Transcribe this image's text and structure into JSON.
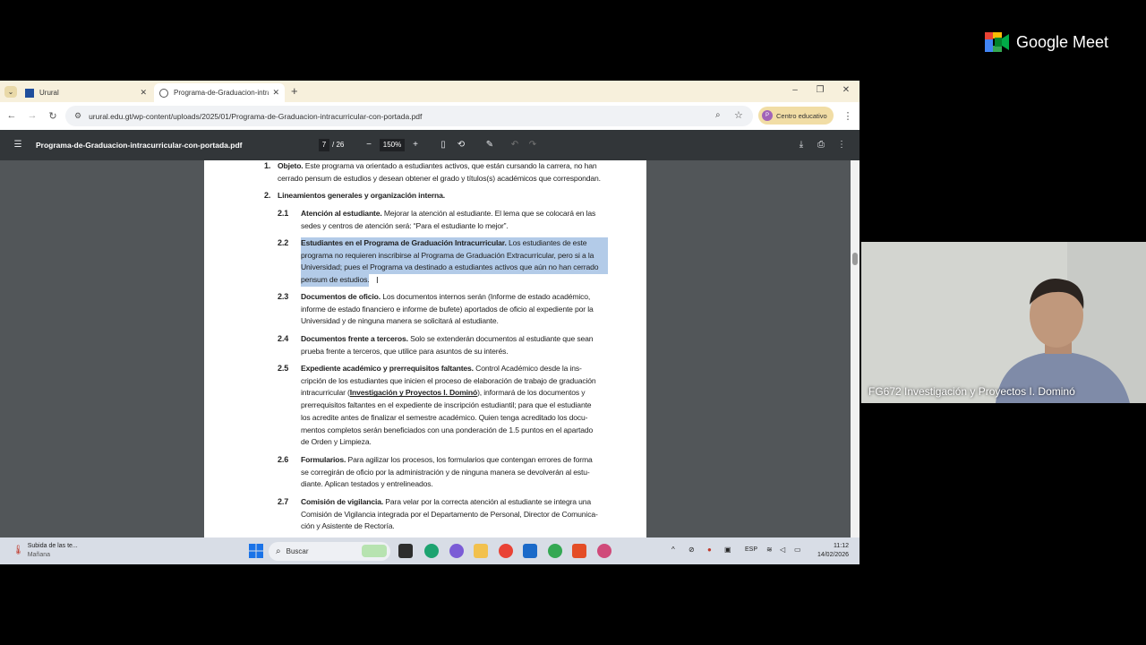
{
  "meet": {
    "brand": "Google Meet"
  },
  "browser": {
    "tabs": [
      {
        "title": "Urural",
        "active": false
      },
      {
        "title": "Programa-de-Graduacion-intra",
        "active": true
      }
    ],
    "url": "urural.edu.gt/wp-content/uploads/2025/01/Programa-de-Graduacion-intracurricular-con-portada.pdf",
    "profile": {
      "initial": "P",
      "label": "Centro educativo"
    }
  },
  "pdf_viewer": {
    "filename": "Programa-de-Graduacion-intracurricular-con-portada.pdf",
    "page": "7",
    "page_total": "/ 26",
    "zoom": "150%"
  },
  "document": {
    "s1": {
      "num": "1.",
      "title": "Objeto.",
      "l1": " Este programa va orientado a estudiantes activos, que están cursando la carrera, no han",
      "l2": "cerrado pensum de estudios y desean obtener el grado y títulos(s) académicos que correspondan."
    },
    "s2": {
      "num": "2.",
      "title": "Lineamientos generales y organización interna."
    },
    "s21": {
      "num": "2.1",
      "title": "Atención al estudiante.",
      "l1": " Mejorar la atención al estudiante. El lema que se colocará en las",
      "l2": "sedes y centros de atención será: “Para el estudiante lo mejor”."
    },
    "s22": {
      "num": "2.2",
      "title": "Estudiantes en el Programa de Graduación Intracurricular.",
      "l1": " Los estudiantes de este",
      "l2": "programa no requieren inscribirse al Programa de Graduación Extracurricular, pero si a la",
      "l3": "Universidad; pues el Programa va destinado a estudiantes activos que aún no han cerrado",
      "l4": "pensum de estudios."
    },
    "s23": {
      "num": "2.3",
      "title": "Documentos de oficio.",
      "l1": " Los documentos internos serán (Informe de estado académico,",
      "l2": "informe de estado financiero e informe de bufete) aportados de oficio al expediente por la",
      "l3": "Universidad y de ninguna manera se solicitará al estudiante."
    },
    "s24": {
      "num": "2.4",
      "title": "Documentos frente a terceros.",
      "l1": " Solo se extenderán documentos al estudiante que sean",
      "l2": "prueba frente a terceros, que utilice para asuntos de su interés."
    },
    "s25": {
      "num": "2.5",
      "title": "Expediente académico y prerrequisitos faltantes.",
      "l1": " Control Académico desde la ins-",
      "l2": "cripción de los estudiantes que inicien el proceso de elaboración de trabajo de graduación",
      "l3a": "intracurricular (",
      "l3u": "Investigación y Proyectos I. Dominó",
      "l3b": "), informará de los documentos y",
      "l4": "prerrequisitos faltantes en el expediente de inscripción estudiantil; para que el estudiante",
      "l5": "los acredite antes de finalizar el semestre académico. Quien tenga acreditado los docu-",
      "l6": "mentos completos serán beneficiados con una ponderación de 1.5 puntos en el apartado",
      "l7": "de Orden y Limpieza."
    },
    "s26": {
      "num": "2.6",
      "title": "Formularios.",
      "l1": " Para agilizar los procesos, los formularios que contengan errores de forma",
      "l2": "se corregirán de oficio por la administración y de ninguna manera se devolverán al estu-",
      "l3": "diante. Aplican testados y entrelineados."
    },
    "s27": {
      "num": "2.7",
      "title": "Comisión de vigilancia.",
      "l1": " Para velar por la correcta atención al estudiante se integra una",
      "l2": "Comisión de Vigilancia integrada por el Departamento de Personal, Director de Comunica-",
      "l3": "ción y Asistente de Rectoría."
    }
  },
  "taskbar": {
    "weather_title": "Subida de las te...",
    "weather_sub": "Mañana",
    "search_placeholder": "Buscar",
    "lang": "ESP",
    "time": "11:12",
    "date": "14/02/2026"
  },
  "participant": {
    "name": "FG672 Investigación y Proyectos I. Dominó"
  }
}
